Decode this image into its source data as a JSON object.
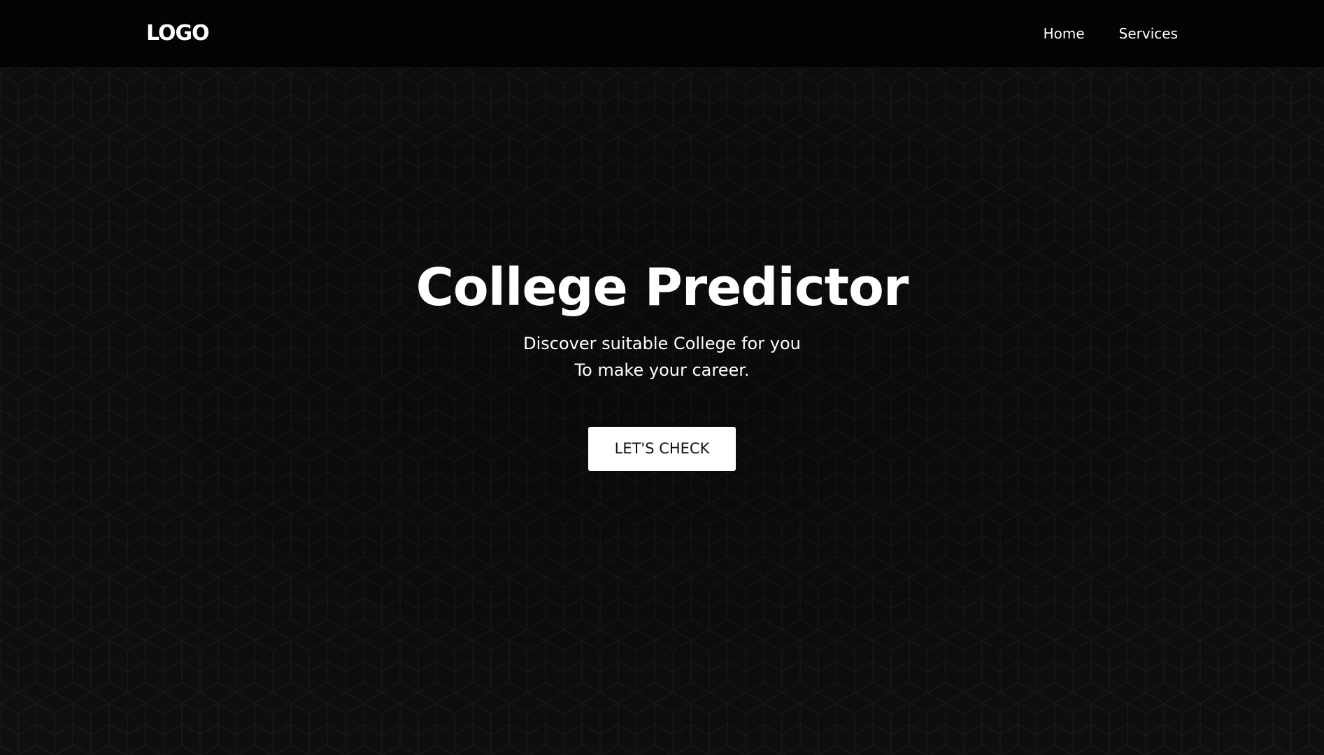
{
  "header": {
    "logo": "LOGO",
    "nav": [
      {
        "label": "Home"
      },
      {
        "label": "Services"
      }
    ]
  },
  "hero": {
    "title": "College Predictor",
    "subtitle_lines": [
      "Discover suitable College for you",
      "To make your career."
    ],
    "cta_label": "LET'S CHECK"
  },
  "colors": {
    "background": "#0f0f0f",
    "header_background": "#050505",
    "text": "#ffffff",
    "button_background": "#ffffff",
    "button_text": "#111111"
  }
}
